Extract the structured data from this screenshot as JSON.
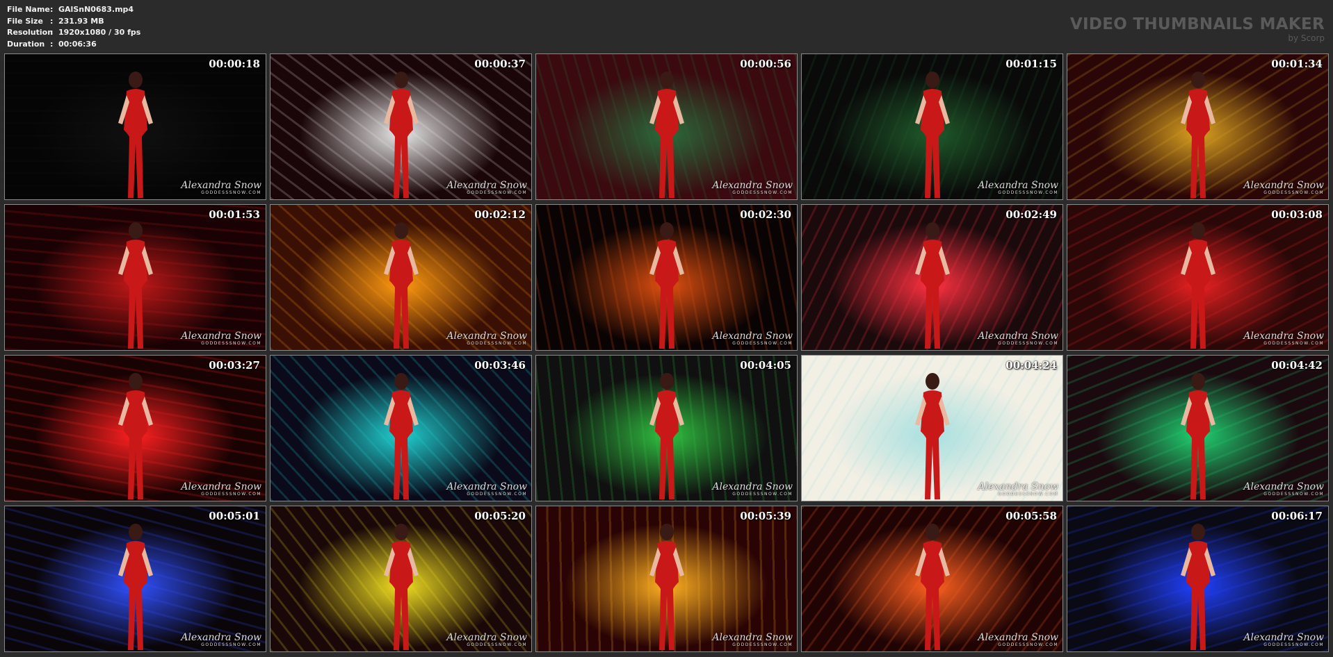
{
  "file_info": {
    "rows": [
      {
        "label": "File Name",
        "sep": ":",
        "value": "GAlSnN0683.mp4"
      },
      {
        "label": "File Size",
        "sep": ":",
        "value": "231.93 MB"
      },
      {
        "label": "Resolution",
        "sep": ":",
        "value": "1920x1080 / 30 fps"
      },
      {
        "label": "Duration",
        "sep": ":",
        "value": "00:06:36"
      }
    ]
  },
  "brand": {
    "title": "VIDEO THUMBNAILS MAKER",
    "byline": "by Scorp"
  },
  "watermark": {
    "signature": "Alexandra Snow",
    "site": "GODDESSSNOW.COM"
  },
  "thumbnails": [
    {
      "timestamp": "00:00:18",
      "bg": "#050505",
      "accent": "#101010"
    },
    {
      "timestamp": "00:00:37",
      "bg": "#1a0608",
      "accent": "#e8e8e8"
    },
    {
      "timestamp": "00:00:56",
      "bg": "#3a0a10",
      "accent": "#2a6a3a"
    },
    {
      "timestamp": "00:01:15",
      "bg": "#0a0a0a",
      "accent": "#1f5a2a"
    },
    {
      "timestamp": "00:01:34",
      "bg": "#2a0606",
      "accent": "#d8a020"
    },
    {
      "timestamp": "00:01:53",
      "bg": "#1a0204",
      "accent": "#c01818"
    },
    {
      "timestamp": "00:02:12",
      "bg": "#3a1004",
      "accent": "#ff9a10"
    },
    {
      "timestamp": "00:02:30",
      "bg": "#0a0303",
      "accent": "#e05010"
    },
    {
      "timestamp": "00:02:49",
      "bg": "#1a0a0c",
      "accent": "#ff3040"
    },
    {
      "timestamp": "00:03:08",
      "bg": "#2a0808",
      "accent": "#e82020"
    },
    {
      "timestamp": "00:03:27",
      "bg": "#180202",
      "accent": "#ff2020"
    },
    {
      "timestamp": "00:03:46",
      "bg": "#0a0a1a",
      "accent": "#20d0d0"
    },
    {
      "timestamp": "00:04:05",
      "bg": "#101010",
      "accent": "#30c040"
    },
    {
      "timestamp": "00:04:24",
      "bg": "#f2efe4",
      "accent": "#a8e0e0"
    },
    {
      "timestamp": "00:04:42",
      "bg": "#1a0a10",
      "accent": "#20d070"
    },
    {
      "timestamp": "00:05:01",
      "bg": "#0a0508",
      "accent": "#3050ff"
    },
    {
      "timestamp": "00:05:20",
      "bg": "#1a0808",
      "accent": "#f0e020"
    },
    {
      "timestamp": "00:05:39",
      "bg": "#2a0404",
      "accent": "#ffb020"
    },
    {
      "timestamp": "00:05:58",
      "bg": "#200404",
      "accent": "#ff6020"
    },
    {
      "timestamp": "00:06:17",
      "bg": "#0a0a14",
      "accent": "#2040ff"
    }
  ]
}
